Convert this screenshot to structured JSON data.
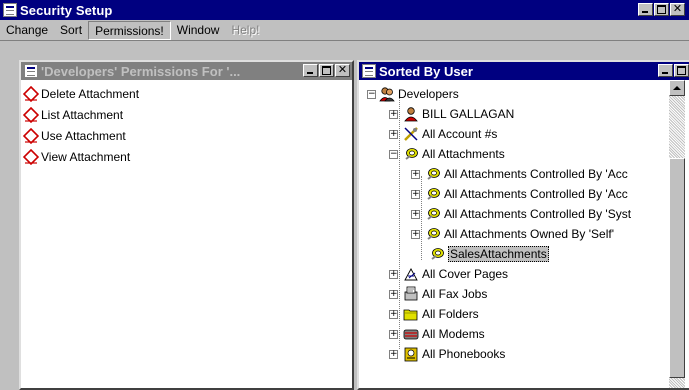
{
  "app": {
    "title": "Security Setup"
  },
  "menu": [
    {
      "label": "Change",
      "state": "normal"
    },
    {
      "label": "Sort",
      "state": "normal"
    },
    {
      "label": "Permissions!",
      "state": "pressed"
    },
    {
      "label": "Window",
      "state": "normal"
    },
    {
      "label": "Help!",
      "state": "disabled"
    }
  ],
  "left_window": {
    "title": "'Developers' Permissions For '...",
    "permissions": [
      {
        "label": "Delete Attachment",
        "icon": "permission-diamond-icon"
      },
      {
        "label": "List Attachment",
        "icon": "permission-diamond-icon"
      },
      {
        "label": "Use Attachment",
        "icon": "permission-diamond-icon"
      },
      {
        "label": "View Attachment",
        "icon": "permission-diamond-icon"
      }
    ]
  },
  "right_window": {
    "title": "Sorted By User",
    "tree": [
      {
        "label": "Developers",
        "icon": "group-icon",
        "level": 0,
        "expander": "minus"
      },
      {
        "label": "BILL GALLAGAN",
        "icon": "user-icon",
        "level": 1,
        "expander": "plus"
      },
      {
        "label": "All Account #s",
        "icon": "account-icon",
        "level": 1,
        "expander": "plus"
      },
      {
        "label": "All Attachments",
        "icon": "attachment-icon",
        "level": 1,
        "expander": "minus"
      },
      {
        "label": "All Attachments Controlled By 'Acc",
        "icon": "attachment-icon",
        "level": 2,
        "expander": "plus"
      },
      {
        "label": "All Attachments Controlled By 'Acc",
        "icon": "attachment-icon",
        "level": 2,
        "expander": "plus"
      },
      {
        "label": "All Attachments Controlled By 'Syst",
        "icon": "attachment-icon",
        "level": 2,
        "expander": "plus"
      },
      {
        "label": "All Attachments Owned By 'Self'",
        "icon": "attachment-icon",
        "level": 2,
        "expander": "plus"
      },
      {
        "label": "SalesAttachments",
        "icon": "attachment-icon",
        "level": 2,
        "expander": "none",
        "selected": true
      },
      {
        "label": "All Cover Pages",
        "icon": "cover-page-icon",
        "level": 1,
        "expander": "plus"
      },
      {
        "label": "All Fax Jobs",
        "icon": "fax-job-icon",
        "level": 1,
        "expander": "plus"
      },
      {
        "label": "All Folders",
        "icon": "folder-icon",
        "level": 1,
        "expander": "plus"
      },
      {
        "label": "All Modems",
        "icon": "modem-icon",
        "level": 1,
        "expander": "plus"
      },
      {
        "label": "All Phonebooks",
        "icon": "phonebook-icon",
        "level": 1,
        "expander": "plus"
      }
    ]
  },
  "colors": {
    "active_title": "#000080",
    "inactive_title": "#808080",
    "face": "#c0c0c0",
    "permission_icon": "#cc0000"
  }
}
